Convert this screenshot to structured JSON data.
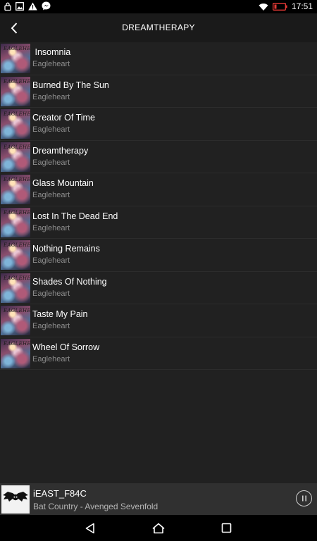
{
  "status_bar": {
    "time": "17:51",
    "left_icons": [
      "lock-icon",
      "image-icon",
      "warning-icon",
      "messenger-icon"
    ],
    "right_icons": [
      "wifi-icon",
      "battery-icon"
    ],
    "battery_color": "#e53935"
  },
  "toolbar": {
    "title": "DREAMTHERAPY",
    "back_icon": "chevron-left-icon"
  },
  "tracks": [
    {
      "title": " Insomnia",
      "artist": "Eagleheart"
    },
    {
      "title": "Burned By The Sun",
      "artist": "Eagleheart"
    },
    {
      "title": "Creator Of Time",
      "artist": "Eagleheart"
    },
    {
      "title": "Dreamtherapy",
      "artist": "Eagleheart"
    },
    {
      "title": "Glass Mountain",
      "artist": "Eagleheart"
    },
    {
      "title": "Lost In The Dead End",
      "artist": "Eagleheart"
    },
    {
      "title": "Nothing Remains",
      "artist": "Eagleheart"
    },
    {
      "title": "Shades Of Nothing",
      "artist": "Eagleheart"
    },
    {
      "title": "Taste My Pain",
      "artist": "Eagleheart"
    },
    {
      "title": "Wheel Of Sorrow",
      "artist": "Eagleheart"
    }
  ],
  "album_art_text": "EAGLEHEART",
  "now_playing": {
    "title": "iEAST_F84C",
    "subtitle": "Bat Country - Avenged Sevenfold",
    "control_icon": "pause-icon"
  },
  "nav_bar": {
    "icons": [
      "back-triangle-icon",
      "home-icon",
      "recents-icon"
    ]
  },
  "colors": {
    "background": "#212121",
    "toolbar": "#1a1a1a",
    "now_playing_bar": "#303030",
    "primary_text": "#ffffff",
    "secondary_text": "#8c8c8c"
  }
}
